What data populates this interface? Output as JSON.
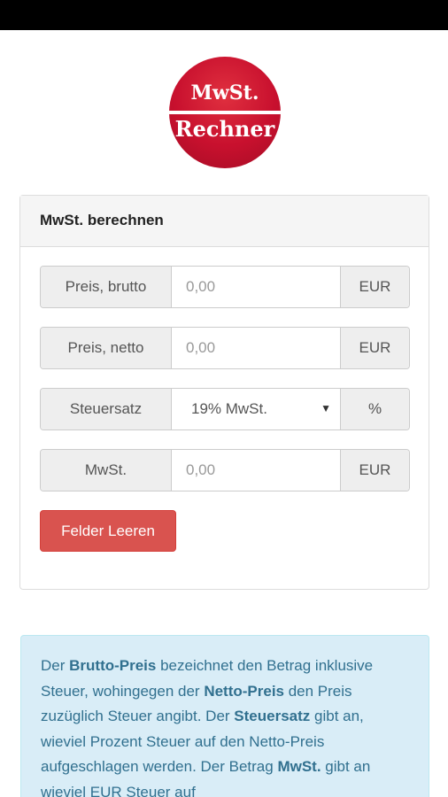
{
  "logo": {
    "line1": "MwSt.",
    "line2": "Rechner"
  },
  "panel": {
    "heading": "MwSt. berechnen",
    "rows": [
      {
        "label": "Preis, brutto",
        "placeholder": "0,00",
        "unit": "EUR"
      },
      {
        "label": "Preis, netto",
        "placeholder": "0,00",
        "unit": "EUR"
      },
      {
        "label": "Steuersatz",
        "selected": "19% MwSt.",
        "unit": "%"
      },
      {
        "label": "MwSt.",
        "placeholder": "0,00",
        "unit": "EUR"
      }
    ],
    "clear_button": "Felder Leeren"
  },
  "info": {
    "p1": "Der ",
    "b1": "Brutto-Preis",
    "p2": " bezeichnet den Betrag inklusive Steuer, wohingegen der ",
    "b2": "Netto-Preis",
    "p3": " den Preis zuzüglich Steuer angibt. Der ",
    "b3": "Steuersatz",
    "p4": " gibt an, wieviel Prozent Steuer auf den Netto-Preis aufgeschlagen werden. Der Betrag ",
    "b4": "MwSt.",
    "p5": " gibt an wieviel EUR Steuer auf"
  },
  "colors": {
    "danger": "#d9534f",
    "info_bg": "#d9edf7",
    "info_text": "#31708f",
    "logo_red": "#c8102e"
  }
}
